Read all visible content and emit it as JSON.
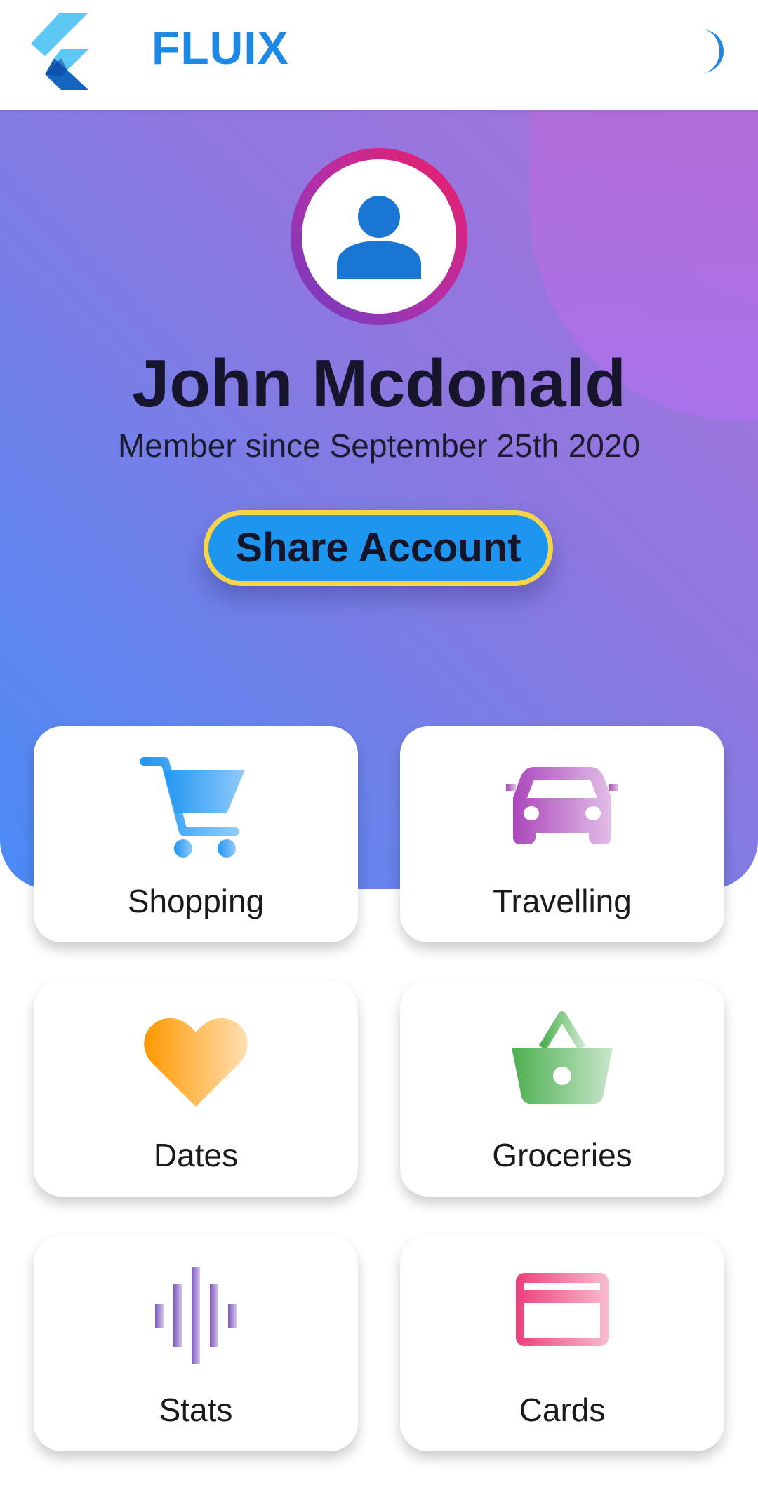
{
  "appbar": {
    "title": "FLUIX",
    "logo_icon": "flutter-logo-icon",
    "theme_icon": "moon-icon"
  },
  "profile": {
    "avatar_icon": "person-icon",
    "name": "John Mcdonald",
    "member_since": "Member since September 25th 2020",
    "share_label": "Share Account"
  },
  "colors": {
    "brand_blue": "#1e88e5",
    "share_border": "#f7d548",
    "hero_gradient_start": "#a873dc",
    "hero_gradient_end": "#4a8bf6"
  },
  "cards": [
    {
      "label": "Shopping",
      "icon": "shopping-cart-icon"
    },
    {
      "label": "Travelling",
      "icon": "car-icon"
    },
    {
      "label": "Dates",
      "icon": "heart-icon"
    },
    {
      "label": "Groceries",
      "icon": "basket-icon"
    },
    {
      "label": "Stats",
      "icon": "graphic-eq-icon"
    },
    {
      "label": "Cards",
      "icon": "credit-card-icon"
    }
  ]
}
